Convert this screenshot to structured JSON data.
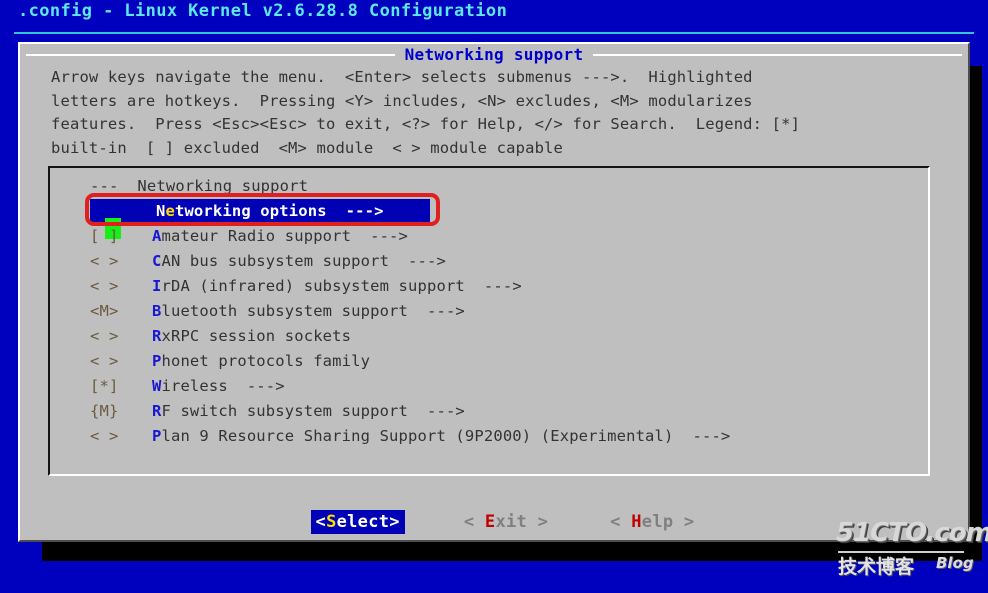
{
  "window": {
    "title": ".config - Linux Kernel v2.6.28.8 Configuration",
    "title_color": "#5ce8f0",
    "background_color": "#0000bf"
  },
  "dialog": {
    "title": "Networking support",
    "title_color": "#0000cc",
    "background_color": "#bfbfbf",
    "help_text": "Arrow keys navigate the menu.  <Enter> selects submenus --->.  Highlighted\nletters are hotkeys.  Pressing <Y> includes, <N> excludes, <M> modularizes\nfeatures.  Press <Esc><Esc> to exit, <?> for Help, </> for Search.  Legend: [*]\nbuilt-in  [ ] excluded  <M> module  < > module capable"
  },
  "menu": {
    "section_header": "---  Networking support",
    "selected_index": 0,
    "highlight_background": "#0000b4",
    "cursor_color": "#17f017",
    "hotkey_color": "#1818d0",
    "selected_hotkey_color": "#ffe000",
    "items": [
      {
        "tag": "",
        "hotkey": "Ne",
        "hotkey_letter": "e",
        "label_before": "N",
        "label_hot": "e",
        "label_after": "tworking options",
        "arrow": "--->",
        "selected": true
      },
      {
        "tag": "[ ]",
        "label_before": "",
        "label_hot": "A",
        "label_after": "mateur Radio support",
        "arrow": "--->",
        "selected": false
      },
      {
        "tag": "< >",
        "label_before": "",
        "label_hot": "C",
        "label_after": "AN bus subsystem support",
        "arrow": "--->",
        "selected": false
      },
      {
        "tag": "< >",
        "label_before": "",
        "label_hot": "I",
        "label_after": "rDA (infrared) subsystem support",
        "arrow": "--->",
        "selected": false
      },
      {
        "tag": "<M>",
        "label_before": "",
        "label_hot": "B",
        "label_after": "luetooth subsystem support",
        "arrow": "--->",
        "selected": false
      },
      {
        "tag": "< >",
        "label_before": "",
        "label_hot": "R",
        "label_after": "xRPC session sockets",
        "arrow": "",
        "selected": false
      },
      {
        "tag": "< >",
        "label_before": "",
        "label_hot": "P",
        "label_after": "honet protocols family",
        "arrow": "",
        "selected": false
      },
      {
        "tag": "[*]",
        "label_before": "",
        "label_hot": "W",
        "label_after": "ireless",
        "arrow": "--->",
        "selected": false
      },
      {
        "tag": "{M}",
        "label_before": "",
        "label_hot": "R",
        "label_after": "F switch subsystem support",
        "arrow": "--->",
        "selected": false
      },
      {
        "tag": "< >",
        "label_before": "",
        "label_hot": "P",
        "label_after": "lan 9 Resource Sharing Support (9P2000) (Experimental)",
        "arrow": "--->",
        "selected": false
      }
    ]
  },
  "buttons": [
    {
      "open": "<",
      "hot": "S",
      "word": "elect",
      "close": ">",
      "primary": true
    },
    {
      "open": "< ",
      "hot": "E",
      "word": "xit",
      "close": " >",
      "primary": false
    },
    {
      "open": "< ",
      "hot": "H",
      "word": "elp",
      "close": " >",
      "primary": false
    }
  ],
  "annotation": {
    "type": "red-rounded-rectangle",
    "color": "#e02020",
    "targets": "Networking options"
  },
  "watermark": {
    "main": "51CTO.com",
    "chinese": "技术博客",
    "blog": "Blog"
  }
}
